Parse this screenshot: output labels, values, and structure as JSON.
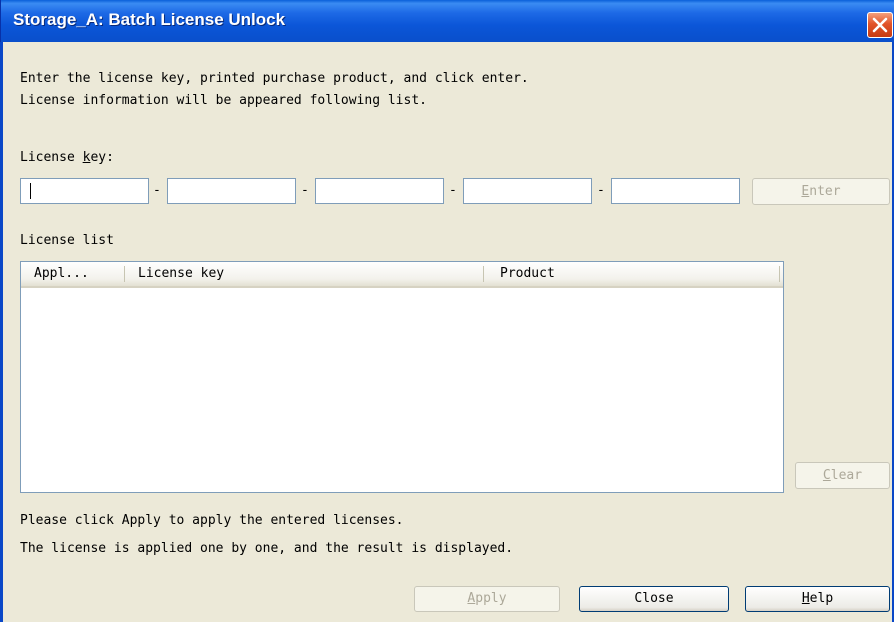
{
  "window": {
    "title": "Storage_A: Batch License Unlock",
    "close_icon": "close-x-icon"
  },
  "instructions": {
    "line1": "Enter the license key, printed purchase product, and click enter.",
    "line2": "License information will be appeared following list."
  },
  "license_key": {
    "label_pre": "License ",
    "label_mnemonic": "k",
    "label_post": "ey:",
    "separator": "-",
    "fields": [
      "",
      "",
      "",
      "",
      ""
    ],
    "enter_mnemonic": "E",
    "enter_rest": "nter",
    "enter_enabled": false
  },
  "license_list": {
    "label": "License list",
    "columns": [
      "Appl...",
      "License key",
      "Product"
    ],
    "rows": [],
    "clear_mnemonic": "C",
    "clear_rest": "lear",
    "clear_enabled": false
  },
  "footer": {
    "line1": "Please click Apply to apply the entered licenses.",
    "line2": "The license is applied one by one, and the result is displayed.",
    "apply_mnemonic": "A",
    "apply_rest": "pply",
    "apply_enabled": false,
    "close_label": "Close",
    "help_mnemonic": "H",
    "help_rest": "elp"
  },
  "colors": {
    "titlebar": "#0A54D6",
    "dialog_bg": "#ECE9D8",
    "field_border": "#7F9DB9",
    "close_button": "#E2542A"
  }
}
